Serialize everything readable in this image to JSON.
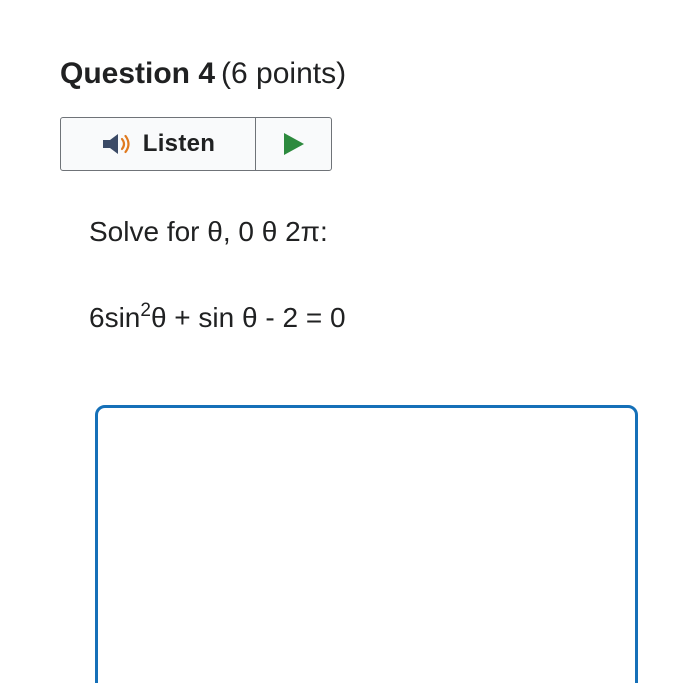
{
  "question": {
    "label": "Question 4",
    "points": "(6 points)"
  },
  "listen": {
    "label": "Listen",
    "speaker_icon": "speaker-icon",
    "play_icon": "play-icon",
    "colors": {
      "play": "#2d8a3e",
      "speaker_body": "#3b4a66",
      "speaker_waves": "#e07a1f"
    }
  },
  "prompt": {
    "text": "Solve for θ, 0 θ 2π:"
  },
  "equation": {
    "coef": "6sin",
    "exponent": "2",
    "rest": "θ + sin θ - 2 = 0"
  },
  "answer_box": {
    "value": "",
    "border_color": "#1570b8"
  }
}
